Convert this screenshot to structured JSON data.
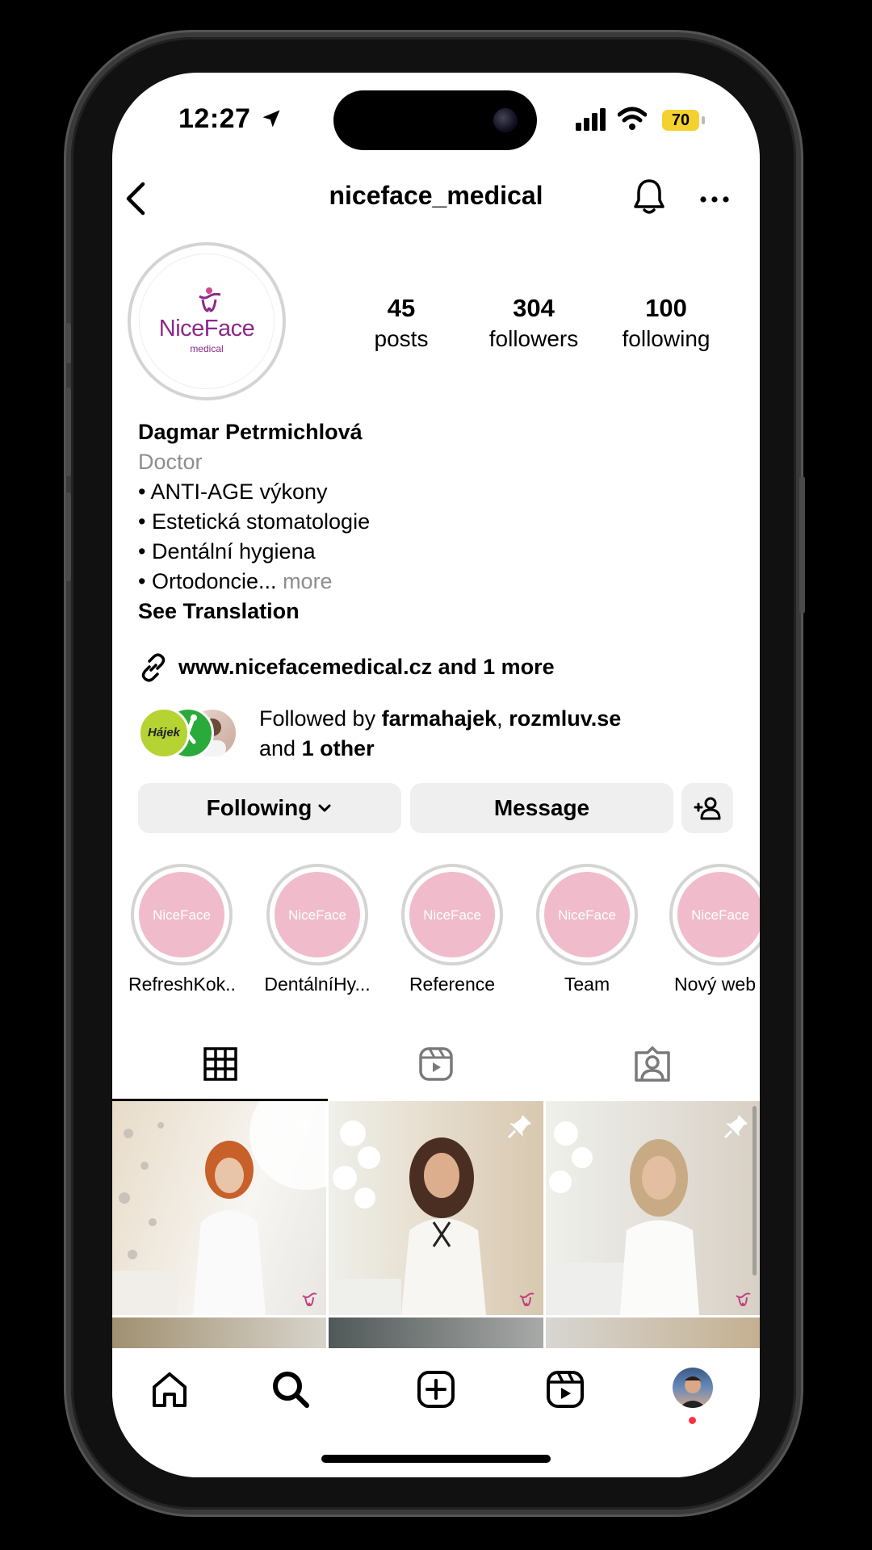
{
  "status_bar": {
    "time": "12:27",
    "battery": "70"
  },
  "header": {
    "username": "niceface_medical"
  },
  "avatar": {
    "logo_text": "NiceFace",
    "logo_sub": "medical"
  },
  "stats": [
    {
      "value": "45",
      "label": "posts"
    },
    {
      "value": "304",
      "label": "followers"
    },
    {
      "value": "100",
      "label": "following"
    }
  ],
  "bio": {
    "name": "Dagmar Petrmichlová",
    "category": "Doctor",
    "lines": [
      "• ANTI-AGE výkony",
      "• Estetická stomatologie",
      "• Dentální hygiena",
      "• Ortodoncie..."
    ],
    "more": "more",
    "see_translation": "See Translation",
    "link": "www.nicefacemedical.cz and 1 more"
  },
  "followed_by": {
    "prefix": "Followed by ",
    "user1": "farmahajek",
    "sep": ", ",
    "user2": "rozmluv.se",
    "and": "and ",
    "other": "1 other",
    "fav1_text": "Hájek"
  },
  "actions": {
    "following": "Following",
    "message": "Message"
  },
  "highlights": [
    {
      "label": "RefreshKok...",
      "logo": "NiceFace"
    },
    {
      "label": "DentálníHy...",
      "logo": "NiceFace"
    },
    {
      "label": "Reference",
      "logo": "NiceFace"
    },
    {
      "label": "Team",
      "logo": "NiceFace"
    },
    {
      "label": "Nový web",
      "logo": "NiceFace"
    }
  ],
  "colors": {
    "brand": "#8a2a8a",
    "highlight_bg": "#f0bccb",
    "button_bg": "#efefef",
    "notification_dot": "#ff3040"
  }
}
